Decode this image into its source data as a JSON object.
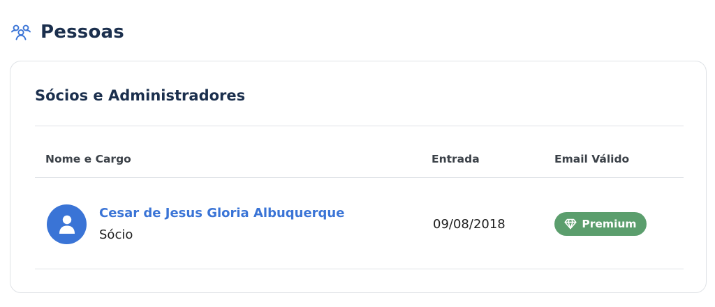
{
  "header": {
    "icon": "people-icon",
    "title": "Pessoas",
    "accent_color": "#3a74d6",
    "title_color": "#1b2f4d"
  },
  "card": {
    "title": "Sócios e Administradores",
    "columns": [
      "Nome e Cargo",
      "Entrada",
      "Email Válido"
    ],
    "rows": [
      {
        "avatar_icon": "user-avatar-icon",
        "name": "Cesar de Jesus Gloria Albuquerque",
        "role": "Sócio",
        "entrada": "09/08/2018",
        "email_badge": {
          "icon": "diamond-icon",
          "label": "Premium",
          "color": "#5b9e6d"
        }
      }
    ]
  }
}
